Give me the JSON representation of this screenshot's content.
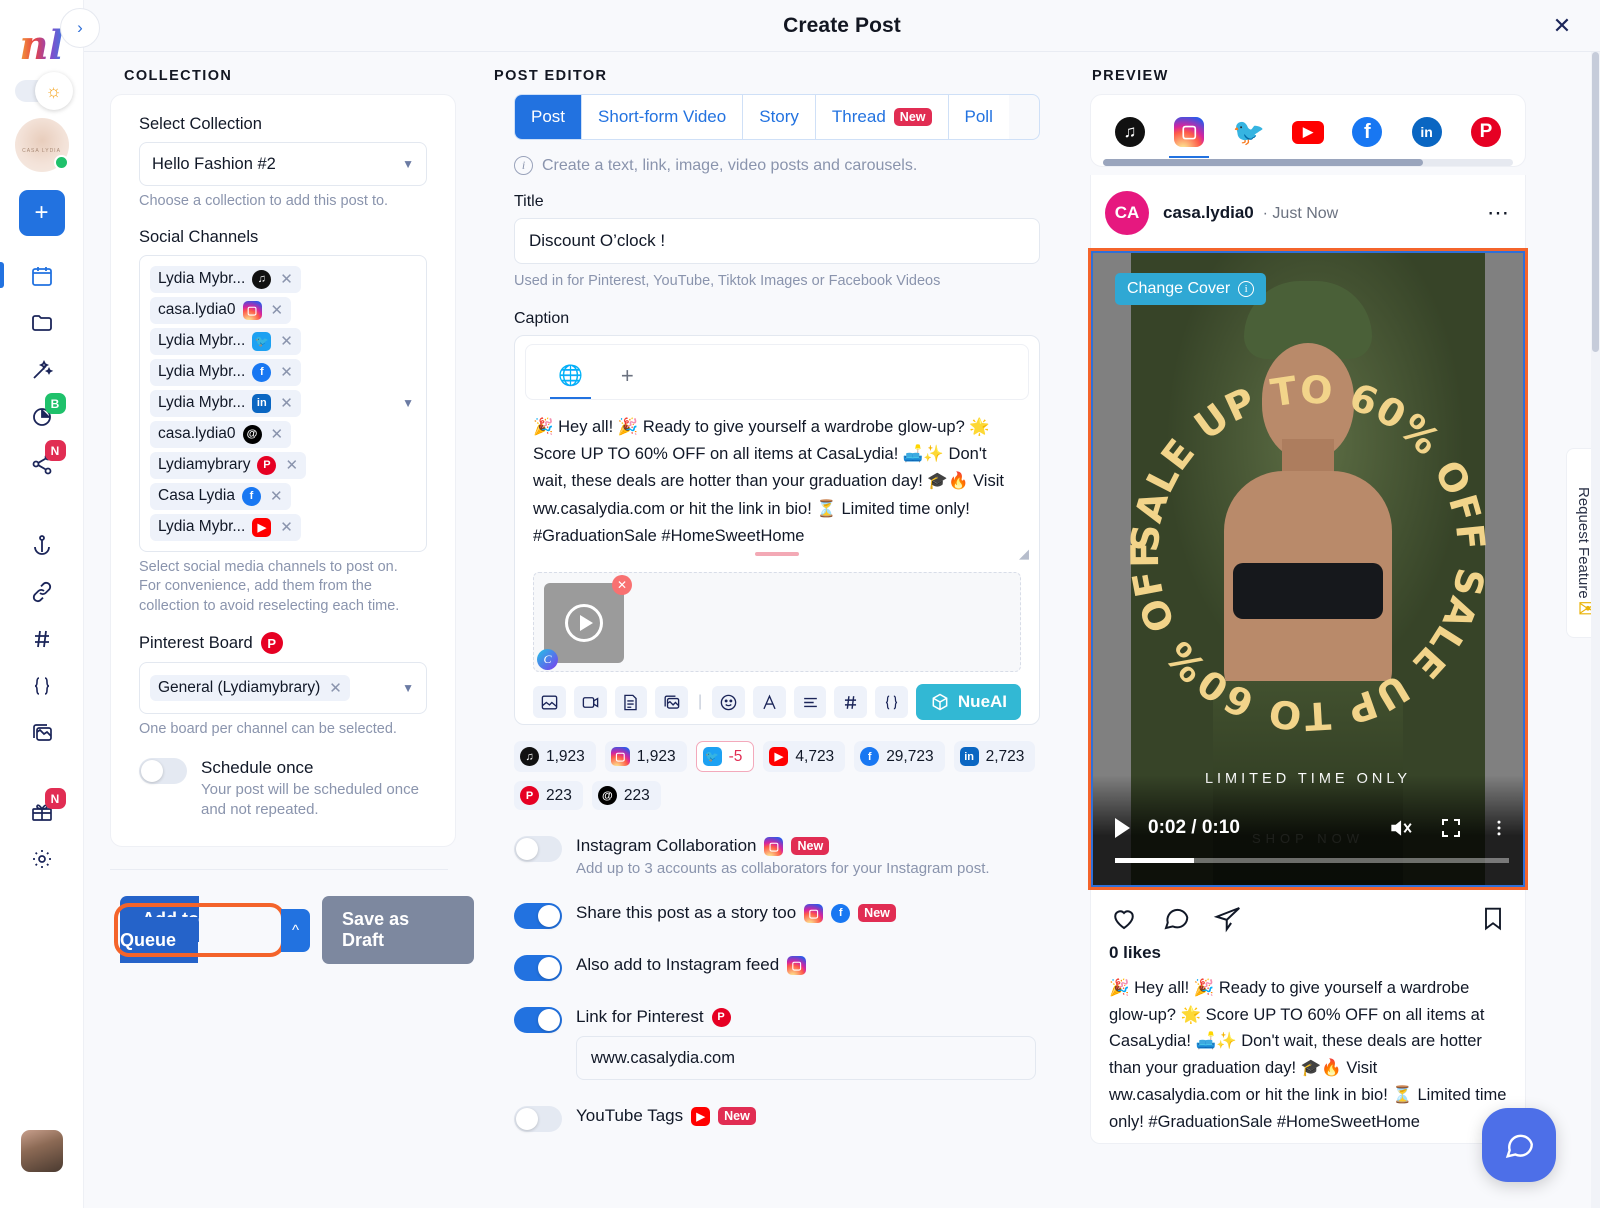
{
  "header": {
    "title": "Create Post",
    "close_icon": "close-icon"
  },
  "rail": {
    "logo": "nl",
    "expand_icon": "chevron-right-icon",
    "theme_icon": "sun-icon",
    "add_label": "+",
    "items": [
      {
        "icon": "calendar-icon",
        "badge": ""
      },
      {
        "icon": "folder-icon",
        "badge": ""
      },
      {
        "icon": "magic-wand-icon",
        "badge": ""
      },
      {
        "icon": "analytics-icon",
        "badge": "B"
      },
      {
        "icon": "share-icon",
        "badge": "N"
      },
      {
        "icon": "anchor-icon",
        "badge": ""
      },
      {
        "icon": "link-icon",
        "badge": ""
      },
      {
        "icon": "hashtag-icon",
        "badge": ""
      },
      {
        "icon": "braces-icon",
        "badge": ""
      },
      {
        "icon": "media-library-icon",
        "badge": ""
      },
      {
        "icon": "gift-icon",
        "badge": "N"
      },
      {
        "icon": "gear-icon",
        "badge": ""
      }
    ]
  },
  "collection": {
    "section_title": "COLLECTION",
    "select_label": "Select Collection",
    "selected_collection": "Hello Fashion #2",
    "collection_hint": "Choose a collection to add this post to.",
    "channels_label": "Social Channels",
    "channels": [
      {
        "name": "Lydia Mybr...",
        "network": "tiktok"
      },
      {
        "name": "casa.lydia0",
        "network": "instagram"
      },
      {
        "name": "Lydia Mybr...",
        "network": "twitter"
      },
      {
        "name": "Lydia Mybr...",
        "network": "facebook"
      },
      {
        "name": "Lydia Mybr...",
        "network": "linkedin"
      },
      {
        "name": "casa.lydia0",
        "network": "threads"
      },
      {
        "name": "Lydiamybrary",
        "network": "pinterest"
      },
      {
        "name": "Casa Lydia",
        "network": "facebook"
      },
      {
        "name": "Lydia Mybr...",
        "network": "youtube"
      }
    ],
    "channels_hint_1": "Select social media channels to post on.",
    "channels_hint_2": "For convenience, add them from the collection to avoid reselecting each time.",
    "pinterest_board_label": "Pinterest Board",
    "pinterest_board_value": "General (Lydiamybrary)",
    "pinterest_board_hint": "One board per channel can be selected.",
    "schedule_once_label": "Schedule once",
    "schedule_once_sub": "Your post will be scheduled once and not repeated.",
    "schedule_once_on": false,
    "add_to_queue": "Add to Queue",
    "queue_caret": "chevron-up-icon",
    "save_as_draft": "Save as Draft"
  },
  "editor": {
    "section_title": "POST EDITOR",
    "tabs": [
      {
        "label": "Post",
        "badge": "",
        "active": true
      },
      {
        "label": "Short-form Video",
        "badge": "",
        "active": false
      },
      {
        "label": "Story",
        "badge": "",
        "active": false
      },
      {
        "label": "Thread",
        "badge": "New",
        "active": false
      },
      {
        "label": "Poll",
        "badge": "",
        "active": false
      }
    ],
    "info_text": "Create a text, link, image, video posts and carousels.",
    "title_label": "Title",
    "title_value": "Discount O’clock !",
    "title_hint": "Used in for Pinterest, YouTube, Tiktok Images or Facebook Videos",
    "caption_label": "Caption",
    "caption_tab_globe": "globe-icon",
    "caption_tab_add": "plus-icon",
    "caption_text": "🎉 Hey all! 🎉 Ready to give yourself a wardrobe glow-up? 🌟 Score UP TO 60% OFF on all items at CasaLydia! 🛋️✨ Don't wait, these deals are hotter than your graduation day! 🎓🔥 Visit ww.casalydia.com or hit the link in bio! ⏳ Limited time only! #GraduationSale #HomeSweetHome",
    "toolbar": [
      "image-icon",
      "video-icon",
      "document-icon",
      "media-library-icon",
      "emoji-icon",
      "font-icon",
      "align-icon",
      "hashtag-icon",
      "braces-icon"
    ],
    "nueai_label": "NueAI",
    "counts": [
      {
        "network": "tiktok",
        "value": "1,923",
        "warn": false
      },
      {
        "network": "instagram",
        "value": "1,923",
        "warn": false
      },
      {
        "network": "twitter",
        "value": "-5",
        "warn": true
      },
      {
        "network": "youtube",
        "value": "4,723",
        "warn": false
      },
      {
        "network": "facebook",
        "value": "29,723",
        "warn": false
      },
      {
        "network": "linkedin",
        "value": "2,723",
        "warn": false
      },
      {
        "network": "pinterest",
        "value": "223",
        "warn": false
      },
      {
        "network": "threads",
        "value": "223",
        "warn": false
      }
    ],
    "options": [
      {
        "label": "Instagram Collaboration",
        "on": false,
        "networks": [
          "instagram"
        ],
        "badge": "New",
        "sub": "Add up to 3 accounts as collaborators for your Instagram post."
      },
      {
        "label": "Share this post as a story too",
        "on": true,
        "networks": [
          "instagram",
          "facebook"
        ],
        "badge": "New",
        "sub": ""
      },
      {
        "label": "Also add to Instagram feed",
        "on": true,
        "networks": [
          "instagram"
        ],
        "badge": "",
        "sub": ""
      },
      {
        "label": "Link for Pinterest",
        "on": true,
        "networks": [
          "pinterest"
        ],
        "badge": "",
        "sub": "",
        "input_value": "www.casalydia.com"
      },
      {
        "label": "YouTube Tags",
        "on": false,
        "networks": [
          "youtube"
        ],
        "badge": "New",
        "sub": ""
      }
    ]
  },
  "preview": {
    "section_title": "PREVIEW",
    "networks": [
      "tiktok",
      "instagram",
      "twitter",
      "youtube",
      "facebook",
      "linkedin",
      "pinterest"
    ],
    "active_network": "instagram",
    "account_initials": "CA",
    "account_name": "casa.lydia0",
    "timestamp": "Just Now",
    "more_icon": "more-horizontal-icon",
    "change_cover_label": "Change Cover",
    "change_cover_info_icon": "info-icon",
    "poster_text_circle": "SALE UP TO 60% OFF SALE UP TO 60% OFF",
    "poster_limited": "LIMITED TIME ONLY",
    "poster_shopnow": "SHOP NOW",
    "video_time": "0:02 / 0:10",
    "video_progress_pct": 20,
    "likes": "0 likes",
    "caption": "🎉 Hey all! 🎉 Ready to give yourself a wardrobe glow-up? 🌟 Score UP TO 60% OFF on all items at CasaLydia! 🛋️✨ Don't wait, these deals are hotter than your graduation day! 🎓🔥 Visit ww.casalydia.com or hit the link in bio! ⏳ Limited time only! #GraduationSale #HomeSweetHome"
  },
  "right": {
    "request_feature": "Request Feature",
    "chat_icon": "chat-bubble-icon"
  },
  "colors": {
    "accent": "#2272e0",
    "highlight": "#f4642b",
    "danger": "#e12d53",
    "nueai": "#32b8d4",
    "poster_gold": "#f2d48a"
  }
}
